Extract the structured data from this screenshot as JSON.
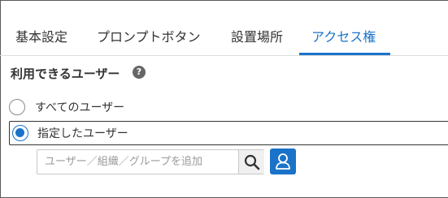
{
  "tabs": [
    {
      "label": "基本設定",
      "active": false
    },
    {
      "label": "プロンプトボタン",
      "active": false
    },
    {
      "label": "設置場所",
      "active": false
    },
    {
      "label": "アクセス権",
      "active": true
    }
  ],
  "section": {
    "title": "利用できるユーザー",
    "help_icon": "question-circle-icon",
    "help_glyph": "?"
  },
  "radio_options": [
    {
      "label": "すべてのユーザー",
      "checked": false
    },
    {
      "label": "指定したユーザー",
      "checked": true
    }
  ],
  "search": {
    "placeholder": "ユーザー／組織／グループを追加",
    "search_icon": "magnifier-icon",
    "user_icon": "user-icon"
  },
  "colors": {
    "accent": "#1a73c8",
    "text": "#333333",
    "border": "#c8c8c8"
  }
}
